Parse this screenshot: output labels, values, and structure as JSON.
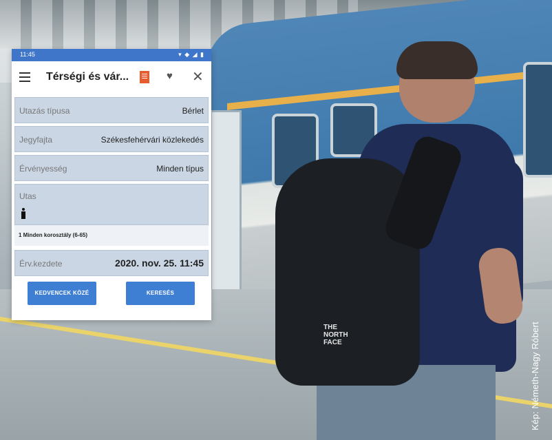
{
  "status_bar": {
    "time": "11:45",
    "icons_text": "▾ ◆ ◢ ▮"
  },
  "app_bar": {
    "title": "Térségi és vár...",
    "menu_icon": "hamburger-icon",
    "ticket_icon": "ticket-icon",
    "favorite_icon": "heart-icon",
    "close_icon": "close-icon",
    "close_glyph": "✕",
    "heart_glyph": "♥"
  },
  "form": {
    "utazas_tipusa": {
      "label": "Utazás típusa",
      "value": "Bérlet"
    },
    "jegyfajta": {
      "label": "Jegyfajta",
      "value": "Székesfehérvári közlekedés"
    },
    "ervenyesseg": {
      "label": "Érvényesség",
      "value": "Minden típus"
    },
    "utas": {
      "label": "Utas",
      "passenger_line": "1 Minden korosztály (6-65)"
    },
    "erv_kezdete": {
      "label": "Érv.kezdete",
      "value": "2020. nov. 25. 11:45"
    }
  },
  "buttons": {
    "favorites": "KEDVENCEK KÖZÉ",
    "search": "KERESÉS"
  },
  "photo": {
    "credit": "Kép: Németh-Nagy Róbert",
    "backpack_logo": "THE NORTH FACE"
  },
  "colors": {
    "accent": "#3f7fd3",
    "status_bar": "#3f76c9",
    "field_bg": "#cad6e4",
    "ticket_icon": "#e85b2d"
  }
}
